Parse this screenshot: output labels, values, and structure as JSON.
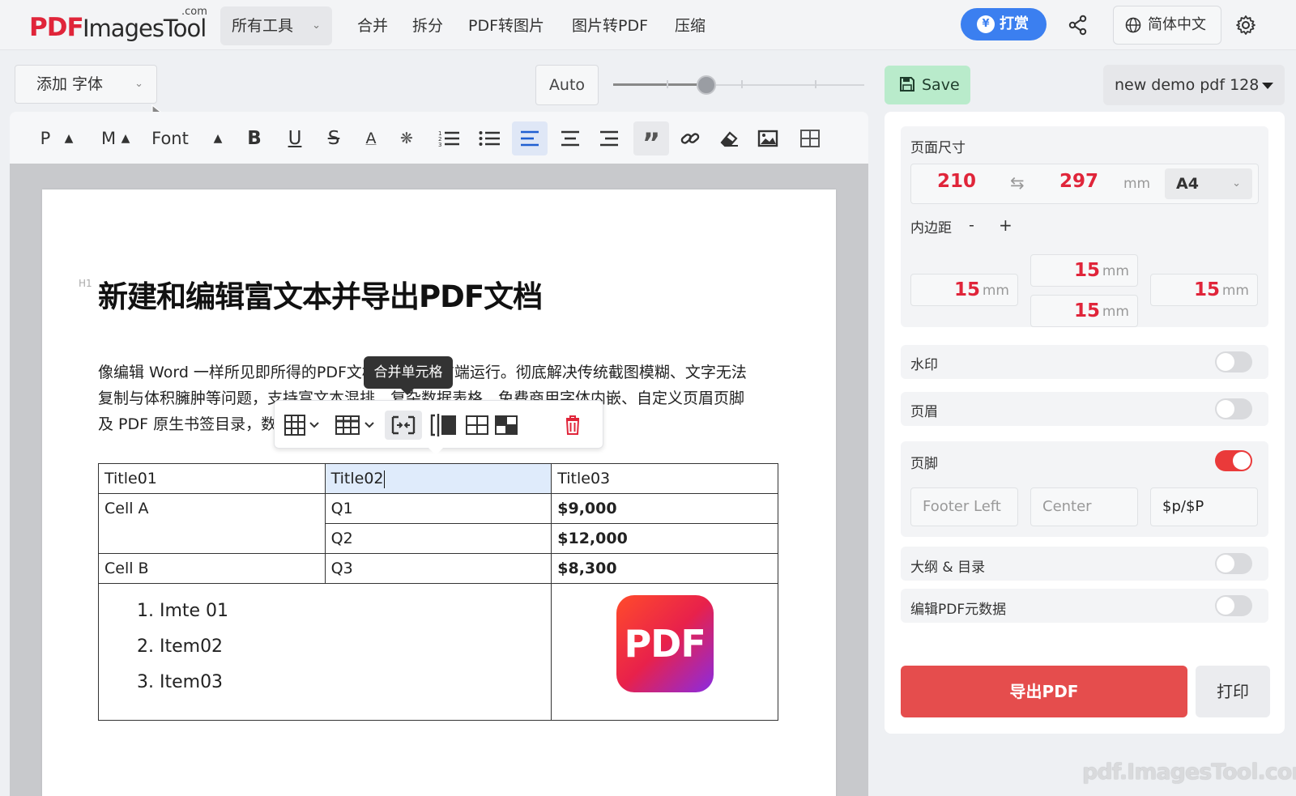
{
  "header": {
    "logo_pdf": "PDF",
    "logo_rest": "ImagesTool",
    "logo_com": ".com",
    "all_tools": "所有工具",
    "nav": [
      "合并",
      "拆分",
      "PDF转图片",
      "图片转PDF",
      "压缩"
    ],
    "tip_label": "打赏",
    "language": "简体中文"
  },
  "editor": {
    "add_font": "添加 字体",
    "auto_label": "Auto",
    "zoom_fraction": 0.37,
    "toolbar": {
      "p_label": "P",
      "m_label": "M",
      "font_label": "Font"
    },
    "h1_tag": "H1",
    "title": "新建和编辑富文本并导出PDF文档",
    "para_lines": [
      "像编辑 Word 一样所见即所得的PDF文档排版，纯前端运行。彻底解决传统截图模糊、文字无法",
      "复制与体积臃肿等问题，支持富文本混排、复杂数据表格、免费商用字体内嵌、自定义页眉页脚",
      "及 PDF 原生书签目录，数"
    ],
    "tooltip": "合并单元格",
    "table": {
      "header": [
        "Title01",
        "Title02",
        "Title03"
      ],
      "cell_a": "Cell A",
      "cell_b": "Cell B",
      "q1": "Q1",
      "q2": "Q2",
      "q3": "Q3",
      "v1": "$9,000",
      "v2": "$12,000",
      "v3": "$8,300",
      "list": [
        "1. Imte 01",
        "2. Item02",
        "3. Item03"
      ],
      "pdf_logo": "PDF"
    }
  },
  "panel": {
    "save": "Save",
    "doc_name": "new demo pdf 128",
    "page_size_label": "页面尺寸",
    "width": "210",
    "height": "297",
    "unit": "mm",
    "paper": "A4",
    "margin_label": "内边距",
    "minus": "-",
    "plus": "+",
    "margins": {
      "top": "15",
      "left": "15",
      "bottom": "15",
      "right": "15"
    },
    "watermark_label": "水印",
    "header_label": "页眉",
    "footer_label": "页脚",
    "footer_left_placeholder": "Footer Left",
    "footer_center_placeholder": "Center",
    "footer_right_value": "$p/$P",
    "outline_label": "大纲 & 目录",
    "metadata_label": "编辑PDF元数据",
    "export_label": "导出PDF",
    "print_label": "打印",
    "toggles": {
      "watermark": false,
      "header": false,
      "footer": true,
      "outline": false,
      "metadata": false
    }
  },
  "watermark_text": "pdf.ImagesTool.com"
}
